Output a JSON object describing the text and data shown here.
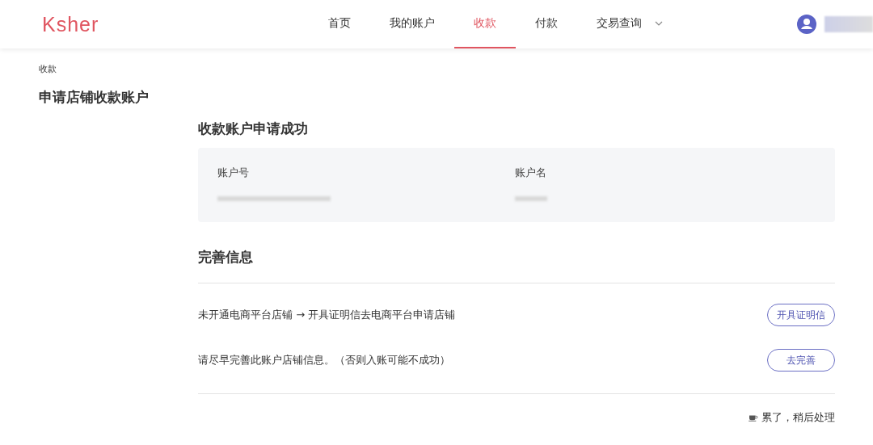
{
  "header": {
    "logo": "Ksher",
    "nav": [
      {
        "label": "首页",
        "selected": false,
        "dropdown": false
      },
      {
        "label": "我的账户",
        "selected": false,
        "dropdown": false
      },
      {
        "label": "收款",
        "selected": true,
        "dropdown": false
      },
      {
        "label": "付款",
        "selected": false,
        "dropdown": false
      },
      {
        "label": "交易查询",
        "selected": false,
        "dropdown": true
      }
    ]
  },
  "breadcrumb": "收款",
  "page_title": "申请店铺收款账户",
  "success": {
    "title": "收款账户申请成功",
    "fields": [
      {
        "label": "账户号"
      },
      {
        "label": "账户名"
      }
    ]
  },
  "complete_info": {
    "title": "完善信息",
    "rows": [
      {
        "text": "未开通电商平台店铺 → 开具证明信去电商平台申请店铺",
        "button": "开具证明信"
      },
      {
        "text": "请尽早完善此账户店铺信息。（否则入账可能不成功）",
        "button": "去完善"
      }
    ]
  },
  "later_link": "累了，稍后处理"
}
